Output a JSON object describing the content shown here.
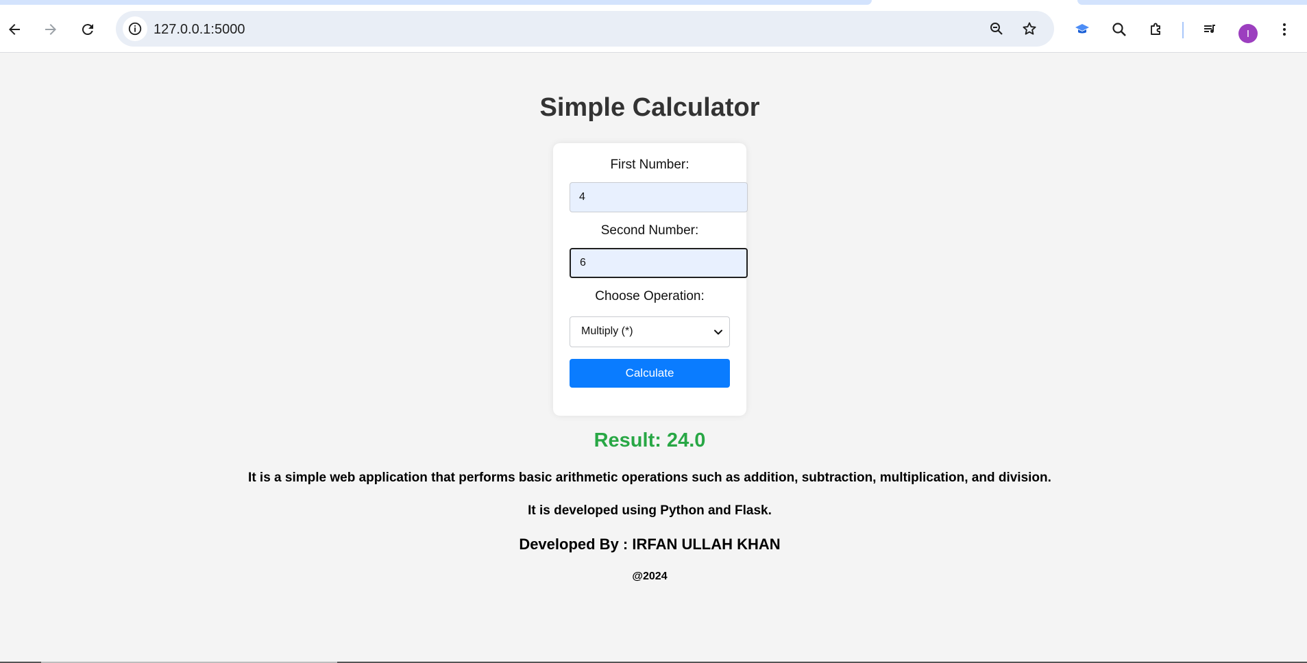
{
  "browser": {
    "url": "127.0.0.1:5000",
    "avatar_letter": "I",
    "icons": {
      "back": "arrow-left-icon",
      "forward": "arrow-right-icon",
      "reload": "reload-icon",
      "site_info": "info-icon",
      "zoom": "zoom-out-icon",
      "bookmark": "star-icon",
      "extension_1": "graduation-cap-icon",
      "extension_2": "search-extension-icon",
      "extensions": "puzzle-icon",
      "media": "media-queue-icon",
      "menu": "kebab-menu-icon"
    }
  },
  "page": {
    "title": "Simple Calculator",
    "form": {
      "first_label": "First Number:",
      "first_value": "4",
      "second_label": "Second Number:",
      "second_value": "6",
      "operation_label": "Choose Operation:",
      "operation_selected": "Multiply (*)",
      "submit_label": "Calculate"
    },
    "result": "Result: 24.0",
    "description_1": "It is a simple web application that performs basic arithmetic operations such as addition, subtraction, multiplication, and division.",
    "description_2": "It is developed using Python and Flask.",
    "developer": "Developed By : IRFAN ULLAH KHAN",
    "copyright": "@2024"
  },
  "colors": {
    "primary_button": "#0a7cff",
    "result_green": "#28a745",
    "input_fill": "#e8f0fe",
    "page_background": "#f4f4f4"
  }
}
